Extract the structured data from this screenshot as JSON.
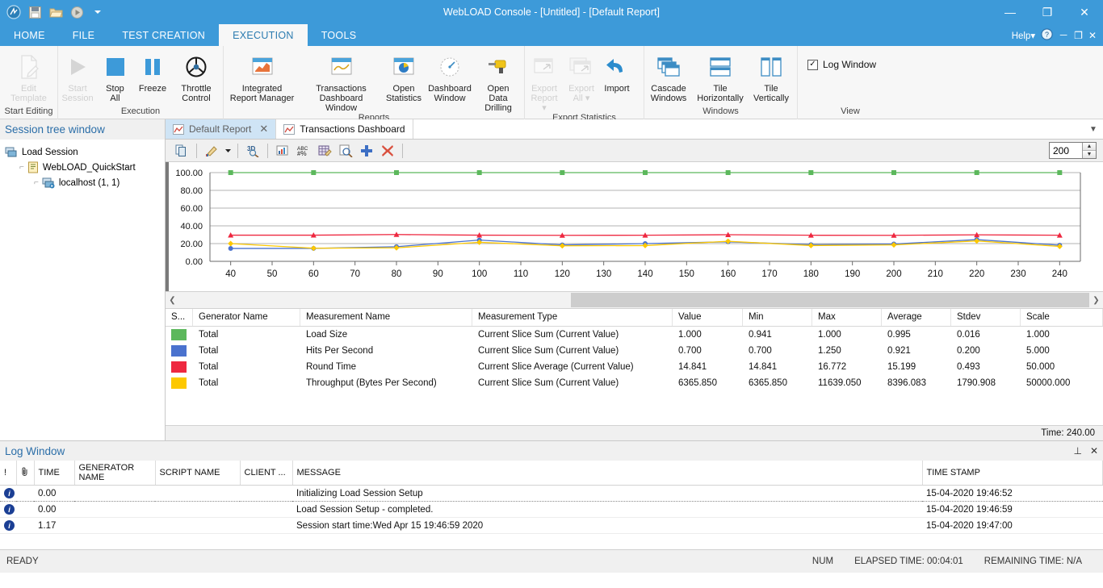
{
  "titlebar": {
    "title": "WebLOAD Console - [Untitled] - [Default Report]",
    "quick_access": [
      {
        "name": "weblogo-icon",
        "label": "WebLOAD"
      },
      {
        "name": "save-icon",
        "label": "Save"
      },
      {
        "name": "open-folder-icon",
        "label": "Open"
      },
      {
        "name": "run-icon",
        "label": "Run"
      },
      {
        "name": "customize-caret-icon",
        "label": "Customize Quick Access Toolbar"
      }
    ],
    "minimize": "—",
    "restore": "❐",
    "close": "✕"
  },
  "ribbon_tabs": [
    {
      "label": "HOME",
      "active": false
    },
    {
      "label": "FILE",
      "active": false
    },
    {
      "label": "TEST CREATION",
      "active": false
    },
    {
      "label": "EXECUTION",
      "active": true
    },
    {
      "label": "TOOLS",
      "active": false
    }
  ],
  "help": {
    "label": "Help",
    "caret": "▾",
    "help_icon": "question-mark-icon",
    "minimize": "－",
    "restore": "❐",
    "close": "✕"
  },
  "ribbon_groups": [
    {
      "label": "Start Editing",
      "buttons": [
        {
          "label": "Edit\nTemplate",
          "icon": "edit-template-icon",
          "disabled": true
        }
      ]
    },
    {
      "label": "Execution",
      "buttons": [
        {
          "label": "Start\nSession",
          "icon": "play-icon",
          "disabled": true
        },
        {
          "label": "Stop\nAll",
          "icon": "stop-square-icon",
          "disabled": false
        },
        {
          "label": "Freeze",
          "icon": "pause-icon",
          "disabled": false
        },
        {
          "label": "Throttle\nControl",
          "icon": "steering-wheel-icon",
          "disabled": false
        }
      ]
    },
    {
      "label": "Reports",
      "buttons": [
        {
          "label": "Integrated\nReport Manager",
          "icon": "integrated-report-icon",
          "disabled": false
        },
        {
          "label": "Transactions\nDashboard Window",
          "icon": "transactions-dashboard-icon",
          "disabled": false
        },
        {
          "label": "Open\nStatistics",
          "icon": "open-statistics-icon",
          "disabled": false
        },
        {
          "label": "Dashboard\nWindow",
          "icon": "gauge-icon",
          "disabled": false
        },
        {
          "label": "Open Data\nDrilling",
          "icon": "drill-icon",
          "disabled": false
        }
      ]
    },
    {
      "label": "Export Statistics",
      "buttons": [
        {
          "label": "Export\nReport ▾",
          "icon": "export-report-icon",
          "disabled": true
        },
        {
          "label": "Export\nAll ▾",
          "icon": "export-all-icon",
          "disabled": true
        },
        {
          "label": "Import",
          "icon": "import-arrow-icon",
          "disabled": false
        }
      ]
    },
    {
      "label": "Windows",
      "buttons": [
        {
          "label": "Cascade\nWindows",
          "icon": "cascade-windows-icon",
          "disabled": false
        },
        {
          "label": "Tile\nHorizontally",
          "icon": "tile-horizontally-icon",
          "disabled": false
        },
        {
          "label": "Tile\nVertically",
          "icon": "tile-vertically-icon",
          "disabled": false
        }
      ]
    },
    {
      "label": "View",
      "checkbox": {
        "label": "Log Window",
        "checked": true,
        "mark": "✓"
      }
    }
  ],
  "session_tree": {
    "header": "Session tree window",
    "nodes": [
      {
        "label": "Load Session",
        "icon": "server-icon",
        "level": 1
      },
      {
        "label": "WebLOAD_QuickStart",
        "icon": "script-icon",
        "level": 2
      },
      {
        "label": "localhost (1, 1)",
        "icon": "host-icon",
        "level": 3
      }
    ]
  },
  "doc_tabs": [
    {
      "label": "Default Report",
      "active": true,
      "icon": "report-chart-icon",
      "close": "✕"
    },
    {
      "label": "Transactions Dashboard",
      "active": false,
      "icon": "report-chart-icon"
    }
  ],
  "chart_toolbar": {
    "buttons": [
      {
        "name": "copy-icon"
      },
      {
        "name": "edit-chart-icon"
      },
      {
        "name": "dropdown-caret-icon"
      },
      {
        "name": "three-d-view-icon"
      },
      {
        "name": "chart-properties-icon"
      },
      {
        "name": "abc-percent-icon"
      },
      {
        "name": "grid-edit-icon"
      },
      {
        "name": "zoom-inspect-icon"
      },
      {
        "name": "add-measurement-icon"
      },
      {
        "name": "remove-measurement-icon"
      }
    ],
    "spinner_value": "200",
    "spinner_up": "▲",
    "spinner_down": "▼"
  },
  "chart_data": {
    "type": "line",
    "title": "",
    "xlabel": "",
    "ylabel": "",
    "xlim": [
      35,
      245
    ],
    "ylim": [
      0,
      100
    ],
    "grid": true,
    "legend": "table-below",
    "x_ticks": [
      40,
      50,
      60,
      70,
      80,
      90,
      100,
      110,
      120,
      130,
      140,
      150,
      160,
      170,
      180,
      190,
      200,
      210,
      220,
      230,
      240
    ],
    "y_ticks": [
      "0.00",
      "20.00",
      "40.00",
      "60.00",
      "80.00",
      "100.00"
    ],
    "marker_x": [
      40,
      60,
      80,
      100,
      120,
      140,
      160,
      180,
      200,
      220,
      240
    ],
    "series": [
      {
        "name": "Load Size",
        "color": "#5cb85c",
        "marker": "square",
        "values": [
          100,
          100,
          100,
          100,
          100,
          100,
          100,
          100,
          100,
          100,
          100
        ]
      },
      {
        "name": "Hits Per Second",
        "color": "#4a72ce",
        "marker": "circle",
        "values": [
          14.5,
          14.6,
          16.5,
          24,
          18.5,
          20,
          22,
          18.8,
          19.5,
          24.5,
          18.2
        ]
      },
      {
        "name": "Round Time",
        "color": "#ee2840",
        "marker": "triangle",
        "values": [
          29.5,
          29.5,
          30.2,
          29.5,
          29.3,
          29.4,
          30,
          29.4,
          29.3,
          29.9,
          29.4
        ]
      },
      {
        "name": "Throughput (Bytes Per Second)",
        "color": "#fdc800",
        "marker": "diamond",
        "values": [
          20,
          14.8,
          15.2,
          21.5,
          17.5,
          17.8,
          22.6,
          17.8,
          18.5,
          23,
          16.8
        ]
      }
    ]
  },
  "stats_grid": {
    "columns": [
      "S...",
      "Generator Name",
      "Measurement Name",
      "Measurement Type",
      "Value",
      "Min",
      "Max",
      "Average",
      "Stdev",
      "Scale"
    ],
    "rows": [
      {
        "color": "#5cb85c",
        "generator": "Total",
        "measurement": "Load Size",
        "type": "Current Slice Sum (Current Value)",
        "value": "1.000",
        "min": "0.941",
        "max": "1.000",
        "average": "0.995",
        "stdev": "0.016",
        "scale": "1.000"
      },
      {
        "color": "#4a72ce",
        "generator": "Total",
        "measurement": "Hits Per Second",
        "type": "Current Slice Sum (Current Value)",
        "value": "0.700",
        "min": "0.700",
        "max": "1.250",
        "average": "0.921",
        "stdev": "0.200",
        "scale": "5.000"
      },
      {
        "color": "#ee2840",
        "generator": "Total",
        "measurement": "Round Time",
        "type": "Current Slice Average (Current Value)",
        "value": "14.841",
        "min": "14.841",
        "max": "16.772",
        "average": "15.199",
        "stdev": "0.493",
        "scale": "50.000"
      },
      {
        "color": "#fdc800",
        "generator": "Total",
        "measurement": "Throughput (Bytes Per Second)",
        "type": "Current Slice Sum (Current Value)",
        "value": "6365.850",
        "min": "6365.850",
        "max": "11639.050",
        "average": "8396.083",
        "stdev": "1790.908",
        "scale": "50000.000"
      }
    ],
    "footer_time": "Time: 240.00"
  },
  "log_window": {
    "title": "Log Window",
    "pin": "⊥",
    "close": "✕",
    "columns": [
      "!",
      "attachment-icon",
      "TIME",
      "GENERATOR NAME",
      "SCRIPT NAME",
      "CLIENT ...",
      "MESSAGE",
      "TIME STAMP"
    ],
    "rows": [
      {
        "severity": "info",
        "time": "0.00",
        "generator": "",
        "script": "",
        "client": "",
        "message": "Initializing Load Session Setup",
        "timestamp": "15-04-2020 19:46:52",
        "selected": true
      },
      {
        "severity": "info",
        "time": "0.00",
        "generator": "",
        "script": "",
        "client": "",
        "message": "Load Session Setup - completed.",
        "timestamp": "15-04-2020 19:46:59",
        "selected": false
      },
      {
        "severity": "info",
        "time": "1.17",
        "generator": "",
        "script": "",
        "client": "",
        "message": "Session start time:Wed Apr 15 19:46:59 2020",
        "timestamp": "15-04-2020 19:47:00",
        "selected": false
      }
    ]
  },
  "statusbar": {
    "ready": "READY",
    "num": "NUM",
    "elapsed": "ELAPSED TIME: 00:04:01",
    "remaining": "REMAINING TIME: N/A"
  },
  "colors": {
    "accent": "#3d9ad9",
    "header_text": "#2b6ea8",
    "series_green": "#5cb85c",
    "series_blue": "#4a72ce",
    "series_red": "#ee2840",
    "series_yellow": "#fdc800"
  }
}
